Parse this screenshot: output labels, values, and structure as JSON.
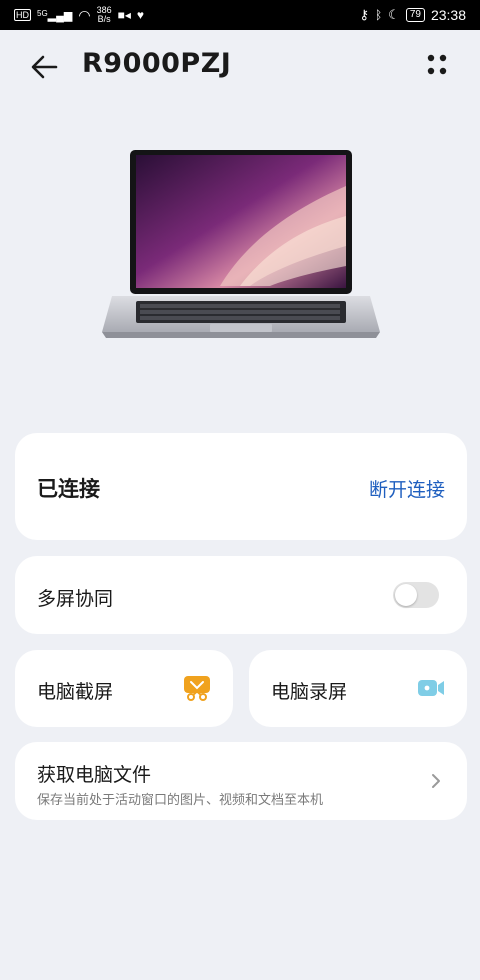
{
  "status_bar": {
    "hd_badge": "HD",
    "signal": "5G",
    "speed_value": "386",
    "speed_unit": "B/s",
    "battery": "79",
    "time": "23:38"
  },
  "header": {
    "title": "R9000PZJ"
  },
  "connection": {
    "status": "已连接",
    "disconnect_label": "断开连接"
  },
  "multi_screen": {
    "label": "多屏协同",
    "enabled": false
  },
  "tiles": {
    "screenshot_label": "电脑截屏",
    "record_label": "电脑录屏"
  },
  "files": {
    "title": "获取电脑文件",
    "subtitle": "保存当前处于活动窗口的图片、视频和文档至本机"
  },
  "colors": {
    "accent": "#1f5fbf",
    "screenshot_icon": "#f0a21e",
    "record_icon": "#7fcde6"
  }
}
